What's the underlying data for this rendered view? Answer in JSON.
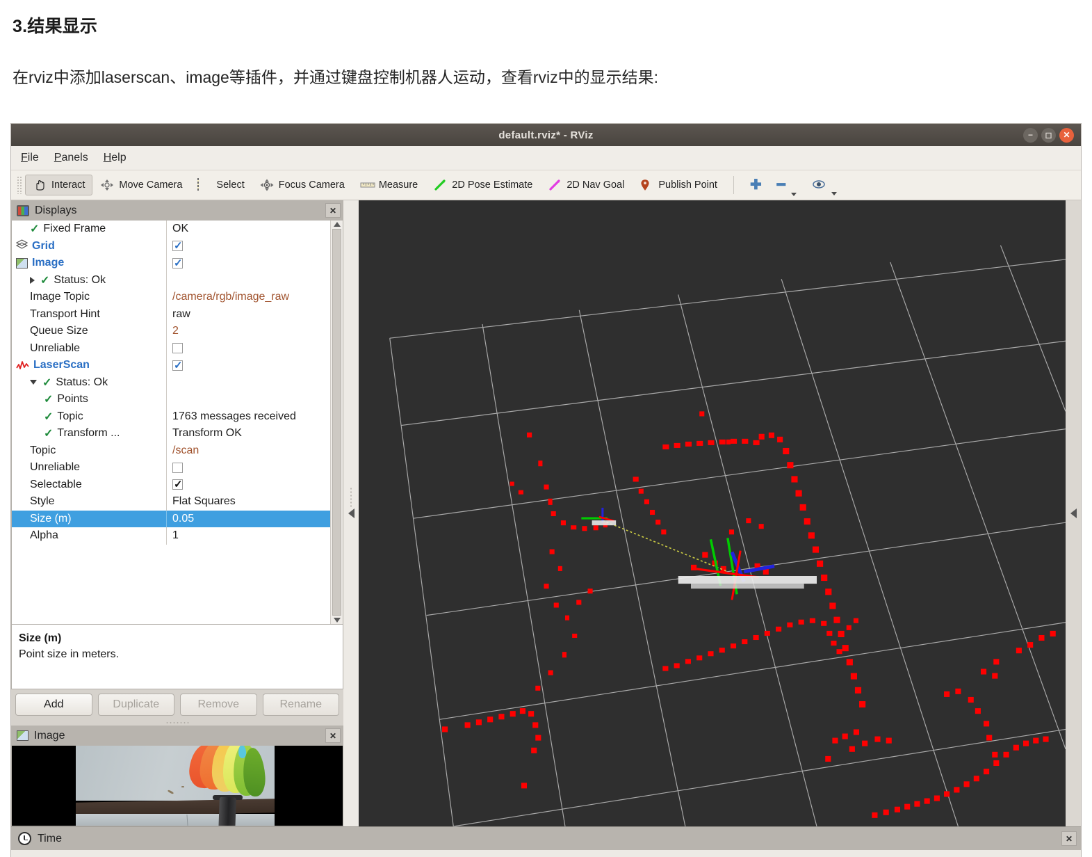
{
  "document": {
    "heading": "3.结果显示",
    "paragraph": "在rviz中添加laserscan、image等插件，并通过键盘控制机器人运动，查看rviz中的显示结果:"
  },
  "window": {
    "title": "default.rviz* - RViz",
    "buttons": {
      "minimize": "–",
      "maximize": "❐",
      "close": "✕"
    }
  },
  "menubar": [
    {
      "label": "File",
      "accel": "F"
    },
    {
      "label": "Panels",
      "accel": "P"
    },
    {
      "label": "Help",
      "accel": "H"
    }
  ],
  "toolbar": {
    "items": [
      {
        "label": "Interact",
        "icon": "hand-icon",
        "active": true
      },
      {
        "label": "Move Camera",
        "icon": "move-camera-icon",
        "active": false
      },
      {
        "label": "Select",
        "icon": "select-icon",
        "active": false
      },
      {
        "label": "Focus Camera",
        "icon": "focus-camera-icon",
        "active": false
      },
      {
        "label": "Measure",
        "icon": "measure-icon",
        "active": false
      },
      {
        "label": "2D Pose Estimate",
        "icon": "pose-estimate-icon",
        "active": false
      },
      {
        "label": "2D Nav Goal",
        "icon": "nav-goal-icon",
        "active": false
      },
      {
        "label": "Publish Point",
        "icon": "publish-point-icon",
        "active": false
      }
    ],
    "extra": [
      {
        "icon": "plus-icon",
        "label": "+"
      },
      {
        "icon": "minus-icon",
        "label": "–"
      },
      {
        "icon": "eye-icon",
        "label": "◉"
      }
    ]
  },
  "displays_panel": {
    "title": "Displays",
    "close_label": "✕",
    "rows": [
      {
        "label": "Fixed Frame",
        "value": "OK",
        "indent": 1,
        "marker": "check",
        "value_type": "text"
      },
      {
        "label": "Grid",
        "value": "",
        "indent": 0,
        "marker": "grid-icon",
        "value_type": "checkbox-on",
        "bold": true
      },
      {
        "label": "Image",
        "value": "",
        "indent": 0,
        "marker": "image-icon",
        "value_type": "checkbox-on",
        "bold": true
      },
      {
        "label": "Status: Ok",
        "value": "",
        "indent": 1,
        "marker": "arrow-right-check",
        "value_type": "none"
      },
      {
        "label": "Image Topic",
        "value": "/camera/rgb/image_raw",
        "indent": 1,
        "marker": "none",
        "value_type": "text-orange"
      },
      {
        "label": "Transport Hint",
        "value": "raw",
        "indent": 1,
        "marker": "none",
        "value_type": "text"
      },
      {
        "label": "Queue Size",
        "value": "2",
        "indent": 1,
        "marker": "none",
        "value_type": "text-orange"
      },
      {
        "label": "Unreliable",
        "value": "",
        "indent": 1,
        "marker": "none",
        "value_type": "checkbox-off"
      },
      {
        "label": "LaserScan",
        "value": "",
        "indent": 0,
        "marker": "laserscan-icon",
        "value_type": "checkbox-on",
        "bold": true
      },
      {
        "label": "Status: Ok",
        "value": "",
        "indent": 1,
        "marker": "arrow-down-check",
        "value_type": "none"
      },
      {
        "label": "Points",
        "value": "",
        "indent": 2,
        "marker": "check",
        "value_type": "none"
      },
      {
        "label": "Topic",
        "value": "1763 messages received",
        "indent": 2,
        "marker": "check",
        "value_type": "text"
      },
      {
        "label": "Transform ...",
        "value": "Transform OK",
        "indent": 2,
        "marker": "check",
        "value_type": "text"
      },
      {
        "label": "Topic",
        "value": "/scan",
        "indent": 1,
        "marker": "none",
        "value_type": "text-orange"
      },
      {
        "label": "Unreliable",
        "value": "",
        "indent": 1,
        "marker": "none",
        "value_type": "checkbox-off"
      },
      {
        "label": "Selectable",
        "value": "",
        "indent": 1,
        "marker": "none",
        "value_type": "checkbox-on-dark"
      },
      {
        "label": "Style",
        "value": "Flat Squares",
        "indent": 1,
        "marker": "none",
        "value_type": "text"
      },
      {
        "label": "Size (m)",
        "value": "0.05",
        "indent": 1,
        "marker": "none",
        "value_type": "text",
        "selected": true
      },
      {
        "label": "Alpha",
        "value": "1",
        "indent": 1,
        "marker": "none",
        "value_type": "text"
      }
    ]
  },
  "description": {
    "title": "Size (m)",
    "text": "Point size in meters."
  },
  "action_buttons": [
    {
      "label": "Add",
      "enabled": true
    },
    {
      "label": "Duplicate",
      "enabled": false
    },
    {
      "label": "Remove",
      "enabled": false
    },
    {
      "label": "Rename",
      "enabled": false
    }
  ],
  "image_panel": {
    "title": "Image",
    "close_label": "✕"
  },
  "time_panel": {
    "title": "Time",
    "close_label": "✕"
  },
  "viewport": {
    "background_color": "#2f2f2f",
    "grid_color": "#b4b4b4",
    "scan_color": "#ff0000",
    "axis_x_color": "#ff0000",
    "axis_y_color": "#00cc00",
    "axis_z_color": "#2222dd",
    "connector_color": "#cccc44",
    "collapse_left": "◀",
    "collapse_right": "◀"
  }
}
